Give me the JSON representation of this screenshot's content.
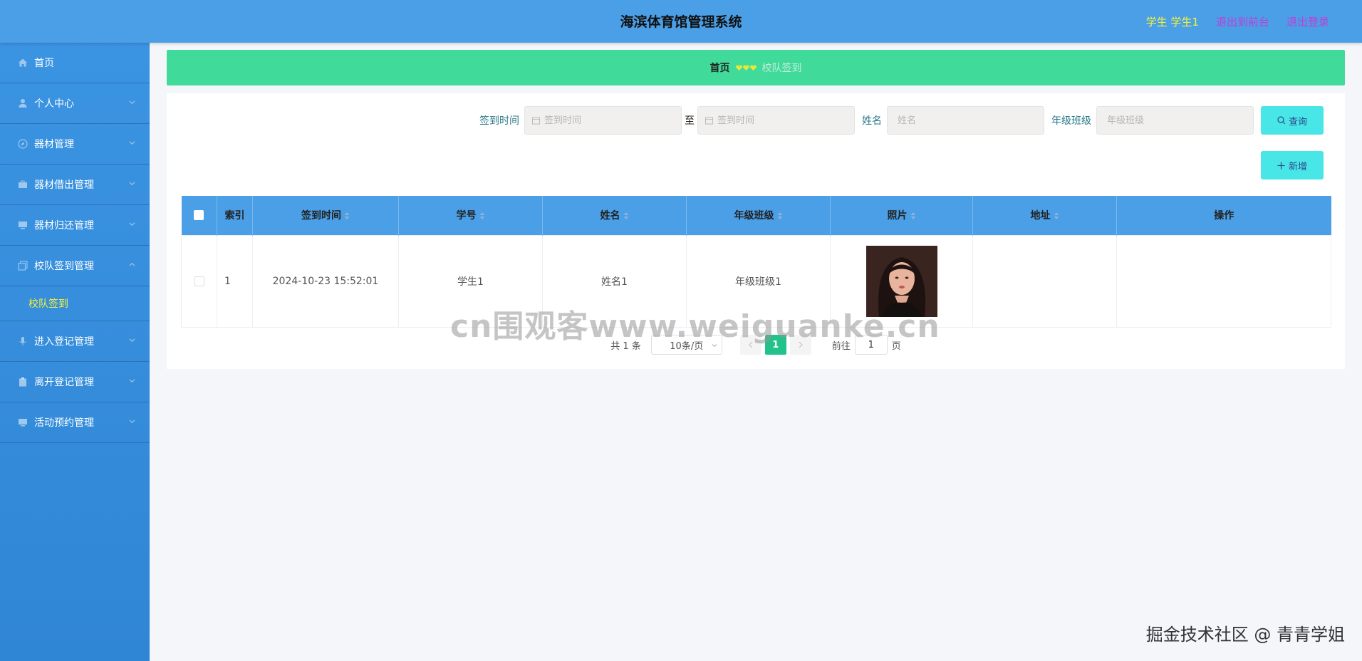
{
  "header": {
    "title": "海滨体育馆管理系统",
    "user": "学生 学生1",
    "back_to_front": "退出到前台",
    "logout": "退出登录"
  },
  "sidebar": {
    "items": [
      {
        "label": "首页",
        "icon": "home-icon"
      },
      {
        "label": "个人中心",
        "icon": "user-icon"
      },
      {
        "label": "器材管理",
        "icon": "compass-icon"
      },
      {
        "label": "器材借出管理",
        "icon": "briefcase-icon"
      },
      {
        "label": "器材归还管理",
        "icon": "monitor-icon"
      },
      {
        "label": "校队签到管理",
        "icon": "copy-icon"
      },
      {
        "label": "进入登记管理",
        "icon": "microphone-icon"
      },
      {
        "label": "离开登记管理",
        "icon": "clipboard-icon"
      },
      {
        "label": "活动预约管理",
        "icon": "monitor-icon"
      }
    ],
    "sub_item": "校队签到"
  },
  "breadcrumb": {
    "home": "首页",
    "current": "校队签到"
  },
  "search": {
    "checkin_time_label": "签到时间",
    "date_start_placeholder": "签到时间",
    "to": "至",
    "date_end_placeholder": "签到时间",
    "name_label": "姓名",
    "name_placeholder": "姓名",
    "class_label": "年级班级",
    "class_placeholder": "年级班级",
    "query_button": "查询",
    "add_button": "新增"
  },
  "table": {
    "headers": [
      "索引",
      "签到时间",
      "学号",
      "姓名",
      "年级班级",
      "照片",
      "地址",
      "操作"
    ],
    "rows": [
      {
        "index": "1",
        "checkin_time": "2024-10-23 15:52:01",
        "student_id": "学生1",
        "name": "姓名1",
        "class": "年级班级1",
        "address": "",
        "actions": ""
      }
    ]
  },
  "pagination": {
    "total": "共 1 条",
    "page_size": "10条/页",
    "current_page": "1",
    "goto_label": "前往",
    "goto_value": "1",
    "page_suffix": "页"
  },
  "watermarks": {
    "center": "cn围观客www.weiguanke.cn",
    "corner": "掘金技术社区 @ 青青学姐"
  },
  "colors": {
    "header": "#4b9fe6",
    "sidebar": "#3b94e2",
    "breadcrumb": "#40db9a",
    "button": "#49e6e8",
    "pager_active": "#24c28b"
  }
}
